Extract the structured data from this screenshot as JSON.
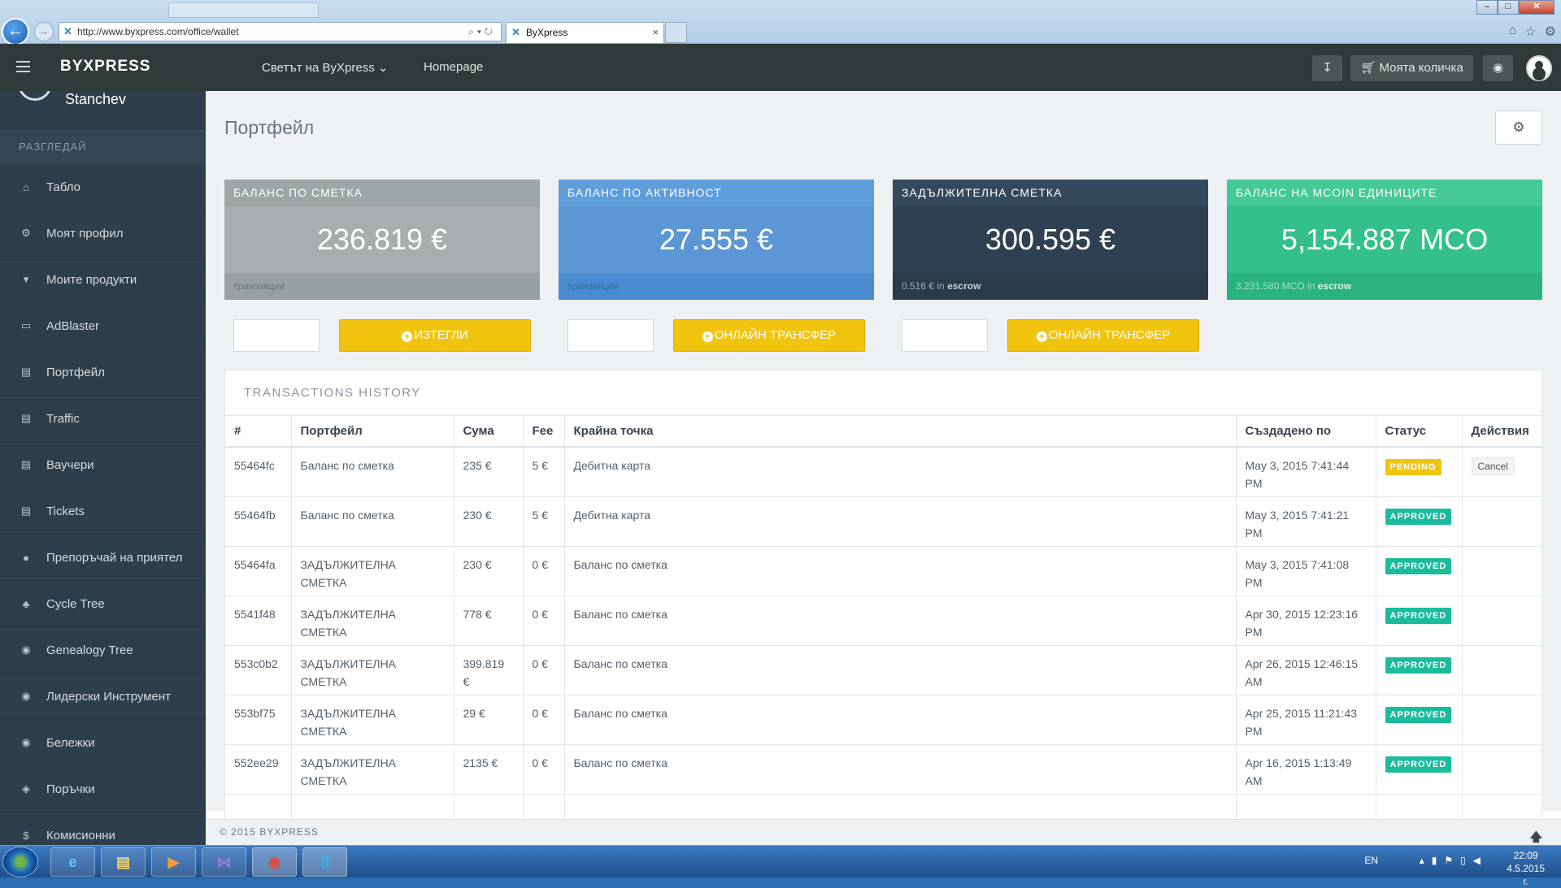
{
  "browser": {
    "url": "http://www.byxpress.com/office/wallet",
    "tab_title": "ByXpress",
    "tab_close": "×"
  },
  "topbar": {
    "brand": "BYXPRESS",
    "nav": [
      "Светът на ByXpress ⌄",
      "Homepage"
    ],
    "cart_label": "Моята количка"
  },
  "sidebar": {
    "user_name": "Stanchev",
    "section_heading": "РАЗГЛЕДАЙ",
    "items": [
      {
        "label": "Табло",
        "icon": "home-icon"
      },
      {
        "label": "Моят профил",
        "icon": "gear-icon"
      },
      {
        "label": "Моите продукти",
        "icon": "cart-icon"
      },
      {
        "label": "AdBlaster",
        "icon": "monitor-icon"
      },
      {
        "label": "Портфейл",
        "icon": "card-icon"
      },
      {
        "label": "Traffic",
        "icon": "card-icon"
      },
      {
        "label": "Ваучери",
        "icon": "card-icon"
      },
      {
        "label": "Tickets",
        "icon": "card-icon"
      },
      {
        "label": "Препоръчай на приятел",
        "icon": "user-icon"
      },
      {
        "label": "Cycle Tree",
        "icon": "tree-icon"
      },
      {
        "label": "Genealogy Tree",
        "icon": "eye-icon"
      },
      {
        "label": "Лидерски Инструмент",
        "icon": "eye-icon"
      },
      {
        "label": "Бележки",
        "icon": "eye-icon"
      },
      {
        "label": "Поръчки",
        "icon": "box-icon"
      },
      {
        "label": "Комисионни",
        "icon": "dollar-icon"
      }
    ]
  },
  "page": {
    "title": "Портфейл"
  },
  "stats": [
    {
      "heading": "БАЛАНС ПО СМЕТКА",
      "value": "236.819 €",
      "footer": "транзакции",
      "footer_bold": ""
    },
    {
      "heading": "БАЛАНС ПО АКТИВНОСТ",
      "value": "27.555 €",
      "footer": "транзакции",
      "footer_bold": ""
    },
    {
      "heading": "ЗАДЪЛЖИТЕЛНА СМЕТКА",
      "value": "300.595 €",
      "footer": "0.516 € in",
      "footer_bold": "escrow"
    },
    {
      "heading": "БАЛАНС НА MCOIN ЕДИНИЦИТЕ",
      "value": "5,154.887 MCO",
      "footer": "3,231.580 MCO in",
      "footer_bold": "escrow"
    }
  ],
  "actions": [
    {
      "label": "ИЗТЕГЛИ"
    },
    {
      "label": "ОНЛАЙН ТРАНСФЕР"
    },
    {
      "label": "ОНЛАЙН ТРАНСФЕР"
    }
  ],
  "history": {
    "title": "TRANSACTIONS HISTORY",
    "columns": [
      "#",
      "Портфейл",
      "Сума",
      "Fee",
      "Крайна точка",
      "Създадено по",
      "Статус",
      "Действия"
    ],
    "rows": [
      {
        "id": "55464fc",
        "wallet": "Баланс по сметка",
        "amount": "235 €",
        "fee": "5 €",
        "endpoint": "Дебитна карта",
        "created": "May 3, 2015 7:41:44 PM",
        "status": "PENDING",
        "action": "Cancel"
      },
      {
        "id": "55464fb",
        "wallet": "Баланс по сметка",
        "amount": "230 €",
        "fee": "5 €",
        "endpoint": "Дебитна карта",
        "created": "May 3, 2015 7:41:21 PM",
        "status": "APPROVED",
        "action": ""
      },
      {
        "id": "55464fa",
        "wallet": "ЗАДЪЛЖИТЕЛНА СМЕТКА",
        "amount": "230 €",
        "fee": "0 €",
        "endpoint": "Баланс по сметка",
        "created": "May 3, 2015 7:41:08 PM",
        "status": "APPROVED",
        "action": ""
      },
      {
        "id": "5541f48",
        "wallet": "ЗАДЪЛЖИТЕЛНА СМЕТКА",
        "amount": "778 €",
        "fee": "0 €",
        "endpoint": "Баланс по сметка",
        "created": "Apr 30, 2015 12:23:16 PM",
        "status": "APPROVED",
        "action": ""
      },
      {
        "id": "553c0b2",
        "wallet": "ЗАДЪЛЖИТЕЛНА СМЕТКА",
        "amount": "399.819 €",
        "fee": "0 €",
        "endpoint": "Баланс по сметка",
        "created": "Apr 26, 2015 12:46:15 AM",
        "status": "APPROVED",
        "action": ""
      },
      {
        "id": "553bf75",
        "wallet": "ЗАДЪЛЖИТЕЛНА СМЕТКА",
        "amount": "29 €",
        "fee": "0 €",
        "endpoint": "Баланс по сметка",
        "created": "Apr 25, 2015 11:21:43 PM",
        "status": "APPROVED",
        "action": ""
      },
      {
        "id": "552ee29",
        "wallet": "ЗАДЪЛЖИТЕЛНА СМЕТКА",
        "amount": "2135 €",
        "fee": "0 €",
        "endpoint": "Баланс по сметка",
        "created": "Apr 16, 2015 1:13:49 AM",
        "status": "APPROVED",
        "action": ""
      }
    ]
  },
  "footer": {
    "text": "© 2015 BYXPRESS"
  },
  "taskbar": {
    "language": "EN",
    "time": "22:09",
    "date": "4.5.2015 г."
  },
  "colors": {
    "topbar": "#2f3a3b",
    "sidebar": "#2f3e4b",
    "accent_yellow": "#f1c40f",
    "approved": "#1abc9c"
  }
}
